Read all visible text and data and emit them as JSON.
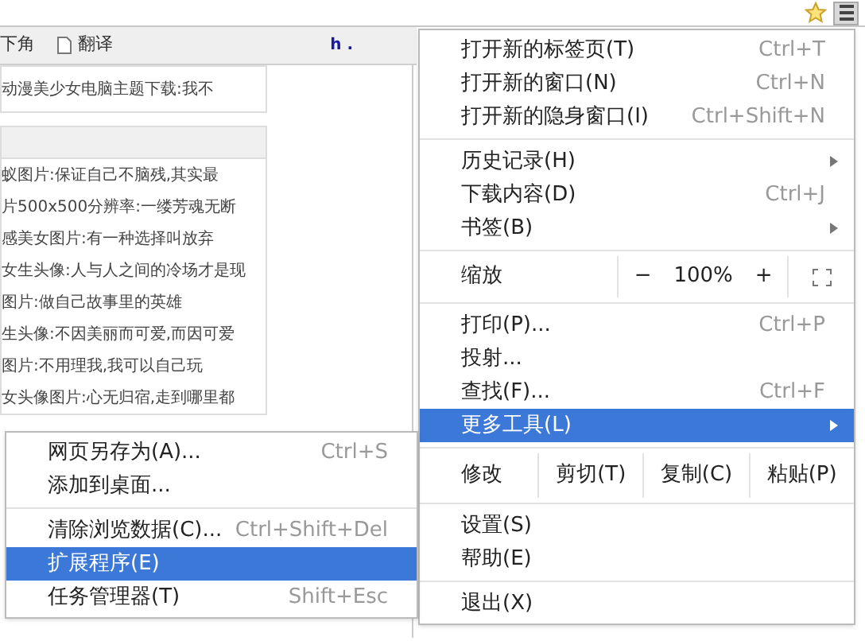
{
  "bookmarks_bar": {
    "items": [
      {
        "label": "下角",
        "kind": "text"
      },
      {
        "label": "翻译",
        "kind": "page"
      }
    ],
    "stray_text": "h ."
  },
  "article_list": {
    "top_items": [
      "动漫美少女电脑主题下载:我不"
    ],
    "items": [
      "蚁图片:保证自己不脑残,其实最",
      "片500x500分辨率:一缕芳魂无断",
      "感美女图片:有一种选择叫放弃",
      "女生头像:人与人之间的冷场才是现",
      "图片:做自己故事里的英雄",
      "生头像:不因美丽而可爱,而因可爱",
      "图片:不用理我,我可以自己玩",
      "女头像图片:心无归宿,走到哪里都"
    ]
  },
  "menu": {
    "items": [
      {
        "kind": "item",
        "label": "打开新的标签页(T)",
        "shortcut": "Ctrl+T",
        "submenu": false,
        "selected": false
      },
      {
        "kind": "item",
        "label": "打开新的窗口(N)",
        "shortcut": "Ctrl+N",
        "submenu": false,
        "selected": false
      },
      {
        "kind": "item",
        "label": "打开新的隐身窗口(I)",
        "shortcut": "Ctrl+Shift+N",
        "submenu": false,
        "selected": false
      },
      {
        "kind": "separator"
      },
      {
        "kind": "item",
        "label": "历史记录(H)",
        "submenu": true,
        "selected": false
      },
      {
        "kind": "item",
        "label": "下载内容(D)",
        "shortcut": "Ctrl+J",
        "submenu": false,
        "selected": false
      },
      {
        "kind": "item",
        "label": "书签(B)",
        "submenu": true,
        "selected": false
      },
      {
        "kind": "separator"
      },
      {
        "kind": "zoom",
        "label": "缩放",
        "minus": "−",
        "value": "100%",
        "plus": "+"
      },
      {
        "kind": "separator"
      },
      {
        "kind": "item",
        "label": "打印(P)...",
        "shortcut": "Ctrl+P",
        "submenu": false,
        "selected": false
      },
      {
        "kind": "item",
        "label": "投射...",
        "submenu": false,
        "selected": false
      },
      {
        "kind": "item",
        "label": "查找(F)...",
        "shortcut": "Ctrl+F",
        "submenu": false,
        "selected": false
      },
      {
        "kind": "item",
        "label": "更多工具(L)",
        "submenu": true,
        "selected": true
      },
      {
        "kind": "separator"
      },
      {
        "kind": "edit",
        "label": "修改",
        "buttons": [
          "剪切(T)",
          "复制(C)",
          "粘贴(P)"
        ]
      },
      {
        "kind": "separator"
      },
      {
        "kind": "item",
        "label": "设置(S)",
        "submenu": false,
        "selected": false
      },
      {
        "kind": "item",
        "label": "帮助(E)",
        "submenu": false,
        "selected": false
      },
      {
        "kind": "separator"
      },
      {
        "kind": "item",
        "label": "退出(X)",
        "submenu": false,
        "selected": false
      }
    ]
  },
  "submenu": {
    "items": [
      {
        "kind": "item",
        "label": "网页另存为(A)...",
        "shortcut": "Ctrl+S",
        "selected": false
      },
      {
        "kind": "item",
        "label": "添加到桌面...",
        "selected": false
      },
      {
        "kind": "separator"
      },
      {
        "kind": "item",
        "label": "清除浏览数据(C)...",
        "shortcut": "Ctrl+Shift+Del",
        "selected": false
      },
      {
        "kind": "item",
        "label": "扩展程序(E)",
        "selected": true
      },
      {
        "kind": "item",
        "label": "任务管理器(T)",
        "shortcut": "Shift+Esc",
        "selected": false
      }
    ]
  }
}
